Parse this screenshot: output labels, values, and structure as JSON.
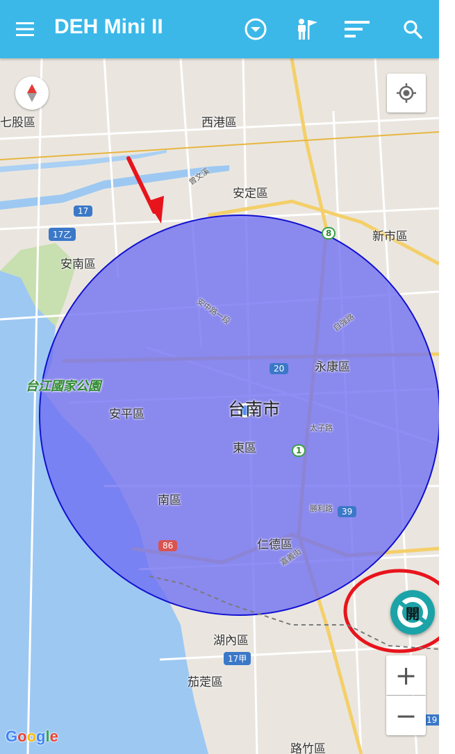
{
  "appbar": {
    "title": "DEH Mini II",
    "menu_icon": "menu-icon",
    "actions": [
      "dropdown-circle-icon",
      "tourist-guide-icon",
      "sort-icon",
      "search-icon"
    ]
  },
  "map": {
    "districts": {
      "qigu": "七股區",
      "xigang": "西港區",
      "anding": "安定區",
      "xinshi": "新市區",
      "annan": "安南區",
      "yongkang": "永康區",
      "anping": "安平區",
      "east": "東區",
      "south": "南區",
      "rende": "仁德區",
      "hunei": "湖內區",
      "qieding": "茄萣區",
      "luzhu": "路竹區"
    },
    "city": "台南市",
    "park": "台江國家公園",
    "river": "曾文溪",
    "roads": {
      "anzhong": "安中路一段",
      "ziqiang": "自強路",
      "taizi": "太子路",
      "shengli": "勝利路",
      "jiayu": "嘉義街"
    },
    "shields": {
      "r17": "17",
      "r17b": "17乙",
      "r8": "8",
      "r20": "20",
      "r1": "1",
      "r39": "39",
      "r86": "86",
      "r17a": "17甲",
      "r19": "19"
    },
    "colors": {
      "circle_fill": "#6e6ef2",
      "circle_stroke": "#1010d0",
      "annotation": "#e8141c",
      "appbar": "#3bb8e8",
      "toggle": "#1ba3a8"
    }
  },
  "controls": {
    "toggle_label": "開",
    "zoom_in": "+",
    "zoom_out": "−",
    "compass_icon": "compass-icon",
    "my_location_icon": "my-location-icon"
  },
  "attribution": "Google"
}
